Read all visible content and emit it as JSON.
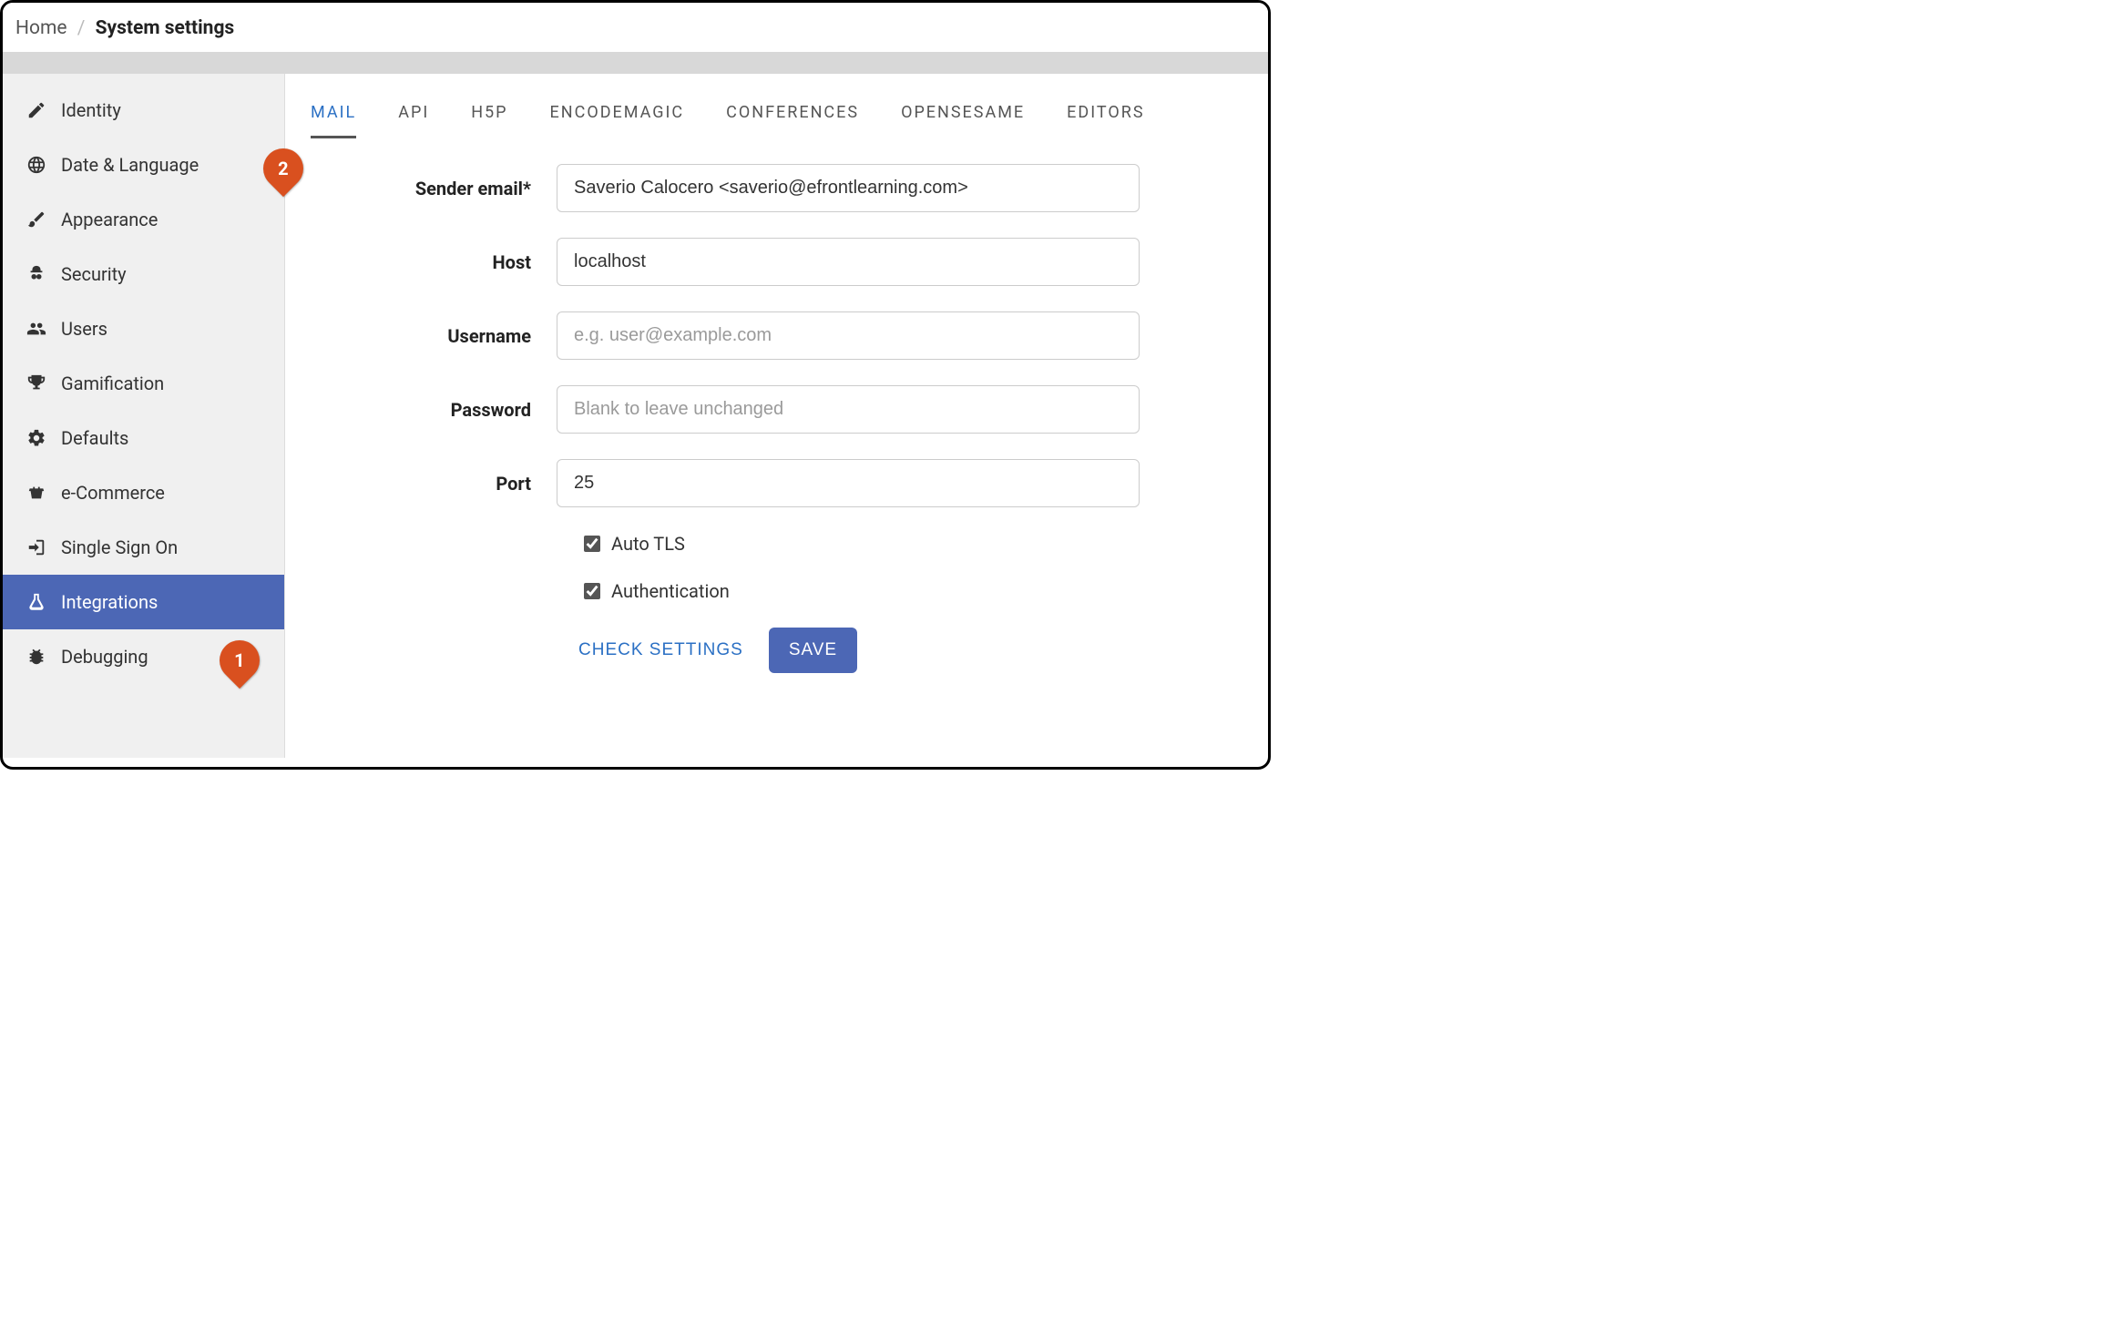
{
  "breadcrumb": {
    "home": "Home",
    "current": "System settings"
  },
  "sidebar": {
    "items": [
      {
        "label": "Identity"
      },
      {
        "label": "Date & Language"
      },
      {
        "label": "Appearance"
      },
      {
        "label": "Security"
      },
      {
        "label": "Users"
      },
      {
        "label": "Gamification"
      },
      {
        "label": "Defaults"
      },
      {
        "label": "e-Commerce"
      },
      {
        "label": "Single Sign On"
      },
      {
        "label": "Integrations"
      },
      {
        "label": "Debugging"
      }
    ]
  },
  "tabs": [
    {
      "label": "MAIL"
    },
    {
      "label": "API"
    },
    {
      "label": "H5P"
    },
    {
      "label": "ENCODEMAGIC"
    },
    {
      "label": "CONFERENCES"
    },
    {
      "label": "OPENSESAME"
    },
    {
      "label": "EDITORS"
    }
  ],
  "form": {
    "sender_label": "Sender email*",
    "sender_value": "Saverio Calocero <saverio@efrontlearning.com>",
    "host_label": "Host",
    "host_value": "localhost",
    "username_label": "Username",
    "username_value": "",
    "username_placeholder": "e.g. user@example.com",
    "password_label": "Password",
    "password_value": "",
    "password_placeholder": "Blank to leave unchanged",
    "port_label": "Port",
    "port_value": "25",
    "autotls_label": "Auto TLS",
    "autotls_checked": true,
    "auth_label": "Authentication",
    "auth_checked": true,
    "check_btn": "CHECK SETTINGS",
    "save_btn": "SAVE"
  },
  "annotations": {
    "one": "1",
    "two": "2"
  }
}
